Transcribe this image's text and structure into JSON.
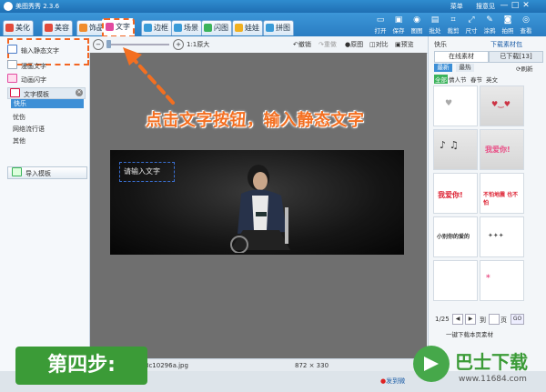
{
  "app": {
    "title": "美图秀秀 2.3.6"
  },
  "menu": [
    "菜单",
    "搜意见"
  ],
  "window_controls": [
    "—",
    "□",
    "✕"
  ],
  "tabs": [
    {
      "label": "美化",
      "color": "#e24a3b"
    },
    {
      "label": "美容",
      "color": "#e24a3b"
    },
    {
      "label": "饰品",
      "color": "#f08d2e"
    },
    {
      "label": "文字",
      "color": "#e24a9f"
    },
    {
      "label": "边框",
      "color": "#3a9bd8"
    },
    {
      "label": "场景",
      "color": "#3a9bd8"
    },
    {
      "label": "闪图",
      "color": "#3bb35b"
    },
    {
      "label": "娃娃",
      "color": "#f0b020"
    },
    {
      "label": "拼图",
      "color": "#3a9bd8"
    }
  ],
  "right_tools": [
    {
      "label": "打开",
      "icon": "folder-icon",
      "glyph": "▭"
    },
    {
      "label": "保存",
      "icon": "save-icon",
      "glyph": "▣"
    },
    {
      "label": "图图",
      "icon": "tutu-icon",
      "glyph": "◉"
    },
    {
      "label": "批处",
      "icon": "batch-icon",
      "glyph": "▤"
    },
    {
      "label": "裁剪",
      "icon": "crop-icon",
      "glyph": "⌗"
    },
    {
      "label": "尺寸",
      "icon": "resize-icon",
      "glyph": "⤢"
    },
    {
      "label": "涂鸦",
      "icon": "brush-icon",
      "glyph": "✎"
    },
    {
      "label": "拍照",
      "icon": "camera-icon",
      "glyph": "◙"
    },
    {
      "label": "查看",
      "icon": "view-icon",
      "glyph": "◎"
    }
  ],
  "left_panel": {
    "items": [
      {
        "label": "输入静态文字",
        "icon": "static-text-icon"
      },
      {
        "label": "漫画文字",
        "icon": "comic-text-icon"
      },
      {
        "label": "动画闪字",
        "icon": "flash-text-icon"
      }
    ],
    "template_header": "文字模板",
    "categories": [
      "快乐",
      "忧伤",
      "网络流行语",
      "其他"
    ],
    "import_button": "导入模板"
  },
  "editor_toolbar": {
    "zoom_label": "1:1原大",
    "actions": [
      "撤销",
      "重做",
      "原图",
      "对比",
      "预览"
    ]
  },
  "canvas": {
    "placeholder": "请输入文字",
    "filename": "8c10296a.jpg",
    "dimensions": "872 × 330"
  },
  "annotation": "点击文字按钮，输入静态文字",
  "step_label": "第四步:",
  "right_panel": {
    "category": "快乐",
    "download_link": "下载素材包",
    "tabs": [
      "在线素材",
      "已下载[13]"
    ],
    "subtabs": [
      "最新",
      "最热"
    ],
    "refresh": "刷新",
    "filters": [
      "全部",
      "情人节",
      "春节",
      "英文"
    ],
    "stickers": [
      "我爱你!",
      "我爱你!",
      "我爱你!",
      "不怕地震 也不怕",
      "小别你的爱的",
      "*"
    ],
    "pagination": {
      "current": "1/25",
      "to_label": "到",
      "page_label": "页",
      "go": "GO"
    },
    "download_all": "一键下载本页素材"
  },
  "bottom": {
    "share": "发到微"
  },
  "watermark": {
    "brand": "巴士下载",
    "url": "www.11684.com"
  }
}
